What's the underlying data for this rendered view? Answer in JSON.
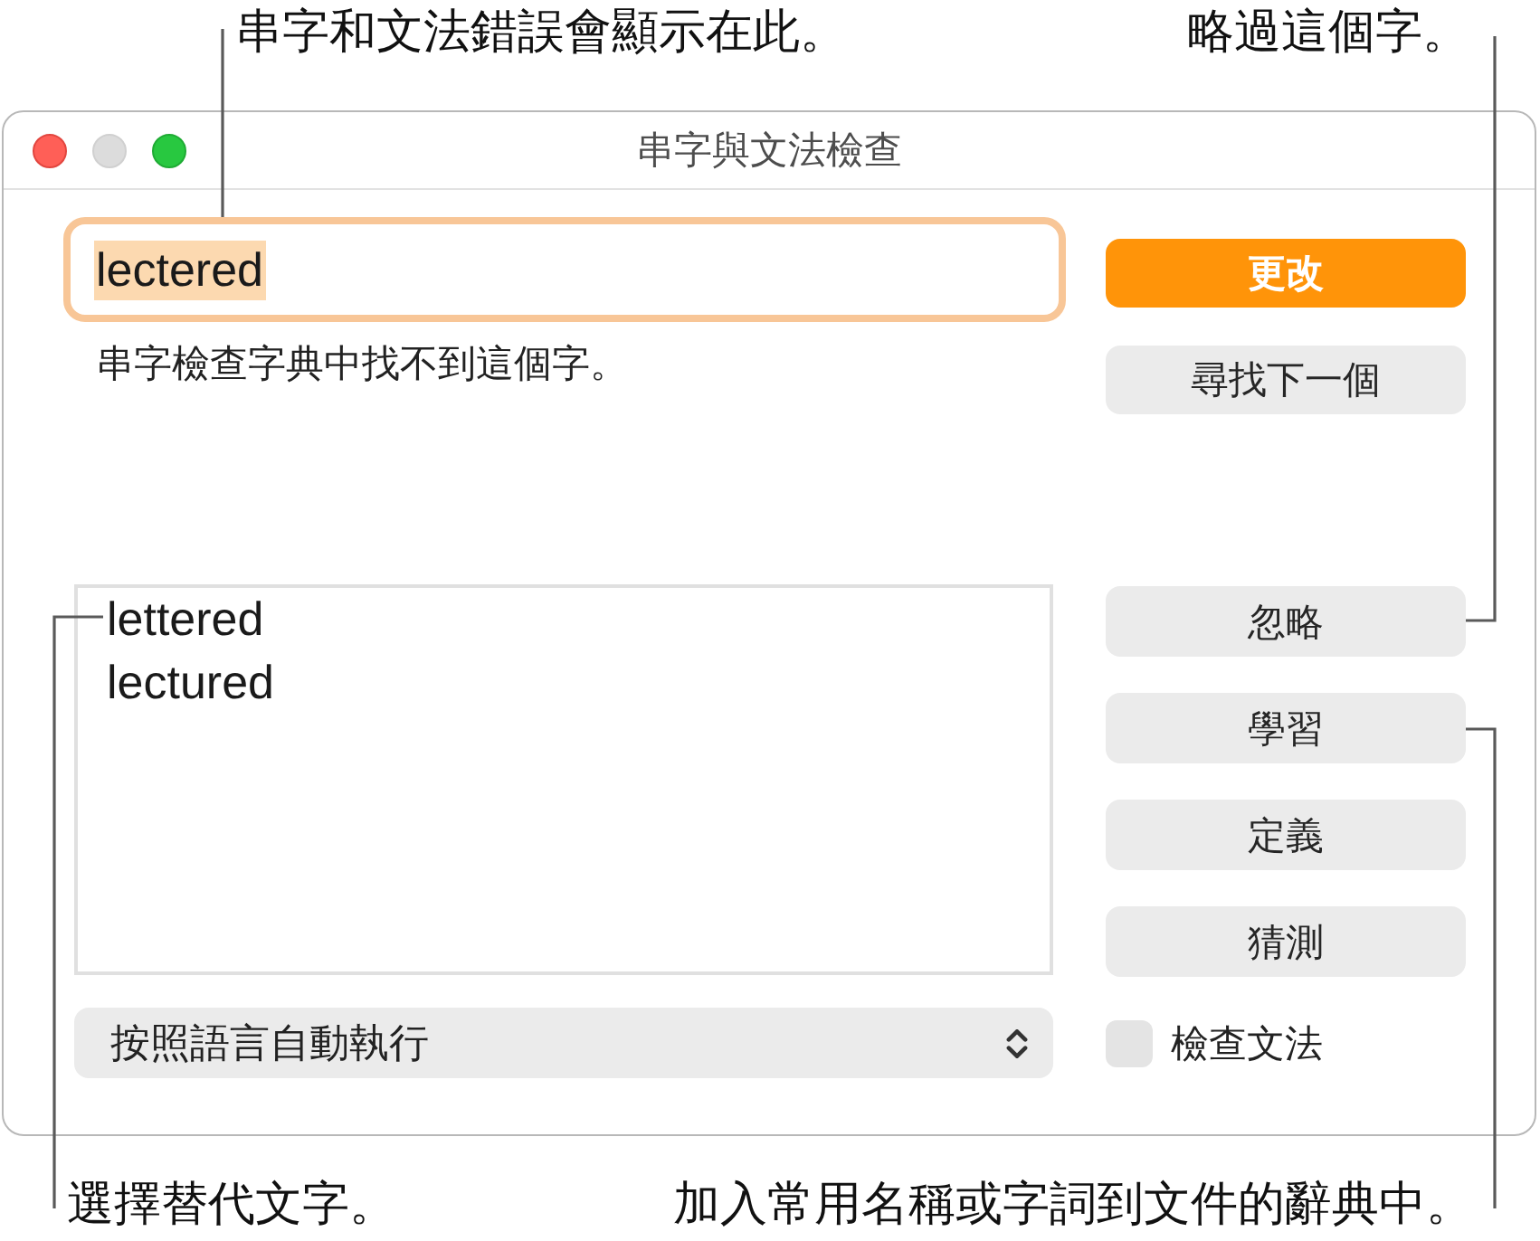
{
  "callouts_top": [
    "串字和文法錯誤會顯示在此。",
    "略過這個字。"
  ],
  "window": {
    "title": "串字與文法檢查",
    "minimize_disabled": true
  },
  "word_field": {
    "value": "lectered",
    "focused": true,
    "value_selected": true
  },
  "message": "串字檢查字典中找不到這個字。",
  "action_buttons": [
    {
      "label": "更改",
      "kind": "default"
    },
    {
      "label": "尋找下一個",
      "kind": "normal"
    }
  ],
  "suggestions": [
    "lettered",
    "lectured"
  ],
  "side_buttons": [
    {
      "label": "忽略",
      "kind": "normal"
    },
    {
      "label": "學習",
      "kind": "normal"
    },
    {
      "label": "定義",
      "kind": "normal"
    },
    {
      "label": "猜測",
      "kind": "normal"
    }
  ],
  "language_popup": {
    "value": "按照語言自動執行"
  },
  "grammar_checkbox": {
    "label": "檢查文法",
    "checked": false
  },
  "callouts_bottom": [
    "選擇替代文字。",
    "加入常用名稱或字詞到文件的辭典中。"
  ]
}
